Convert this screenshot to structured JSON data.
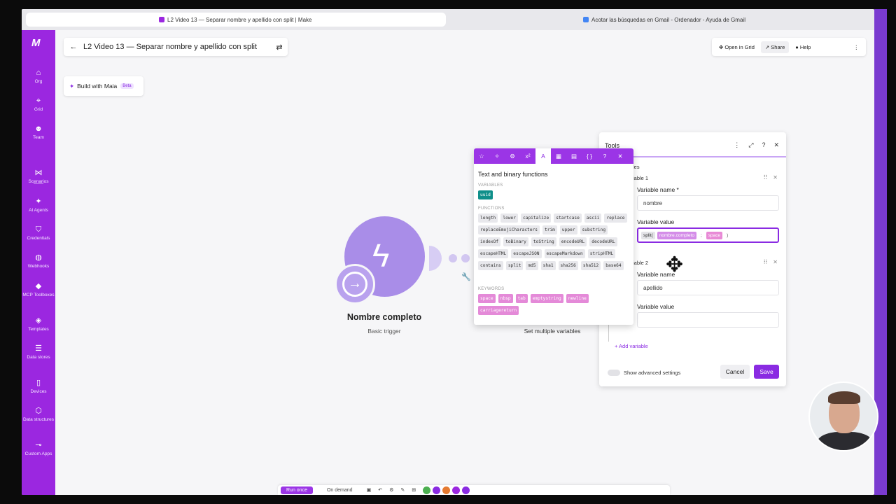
{
  "browser": {
    "tabs": [
      {
        "label": "L2 Video 13 — Separar nombre y apellido con split | Make",
        "active": true
      },
      {
        "label": "Acotar las búsquedas en Gmail - Ordenador - Ayuda de Gmail",
        "active": false
      }
    ]
  },
  "sidebar": {
    "logo": "M",
    "items": [
      {
        "label": "Org",
        "icon": "home-icon"
      },
      {
        "label": "Grid",
        "icon": "grid-icon"
      },
      {
        "label": "Team",
        "icon": "team-icon"
      },
      {
        "label": "Scenarios",
        "icon": "share-nodes-icon"
      },
      {
        "label": "AI Agents",
        "icon": "ai-agent-icon"
      },
      {
        "label": "Credentials",
        "icon": "shield-icon"
      },
      {
        "label": "Webhooks",
        "icon": "globe-icon"
      },
      {
        "label": "MCP Toolboxes",
        "icon": "mcp-icon"
      },
      {
        "label": "Templates",
        "icon": "templates-icon"
      },
      {
        "label": "Data stores",
        "icon": "database-icon"
      },
      {
        "label": "Devices",
        "icon": "device-icon"
      },
      {
        "label": "Data structures",
        "icon": "cube-icon"
      },
      {
        "label": "Custom Apps",
        "icon": "custom-apps-icon"
      }
    ]
  },
  "header": {
    "title": "L2 Video 13 — Separar nombre y apellido con split",
    "maia_label": "Build with Maia",
    "maia_badge": "Beta",
    "open_in_grid": "Open in Grid",
    "share": "Share",
    "help": "Help"
  },
  "modules": {
    "trigger_name": "Nombre completo",
    "trigger_sub": "Basic trigger",
    "next_label": "Set multiple variables"
  },
  "picker": {
    "title": "Text and binary functions",
    "variables_heading": "VARIABLES",
    "variables": [
      "uuid"
    ],
    "functions_heading": "FUNCTIONS",
    "functions": [
      "length",
      "lower",
      "capitalize",
      "startcase",
      "ascii",
      "replace",
      "replaceEmojiCharacters",
      "trim",
      "upper",
      "substring",
      "indexOf",
      "toBinary",
      "toString",
      "encodeURL",
      "decodeURL",
      "escapeHTML",
      "escapeJSON",
      "escapeMarkdown",
      "stripHTML",
      "contains",
      "split",
      "md5",
      "sha1",
      "sha256",
      "sha512",
      "base64"
    ],
    "keywords_heading": "KEYWORDS",
    "keywords": [
      "space",
      "nbsp",
      "tab",
      "emptystring",
      "newline",
      "carriagereturn"
    ]
  },
  "tools": {
    "title": "Tools",
    "section": "les",
    "var1_heading": "iable 1",
    "var1_name_label": "Variable name *",
    "var1_name_value": "nombre",
    "var1_value_label": "Variable value",
    "formula": {
      "fn": "split(",
      "var": "nombre.completo",
      "sep": ";",
      "key": "space",
      "close": ")"
    },
    "var2_heading": "iable 2",
    "var2_name_label": "Variable name",
    "var2_name_value": "apellido",
    "var2_value_label": "Variable value",
    "var2_value": "",
    "add_variable": "+ Add variable",
    "advanced_label": "Show advanced settings",
    "cancel": "Cancel",
    "save": "Save"
  },
  "bottombar": {
    "run_once": "Run once",
    "on_demand": "On demand"
  },
  "colors": {
    "brand": "#9b27e0",
    "accent": "#8a2be2",
    "module": "#a98de8"
  }
}
